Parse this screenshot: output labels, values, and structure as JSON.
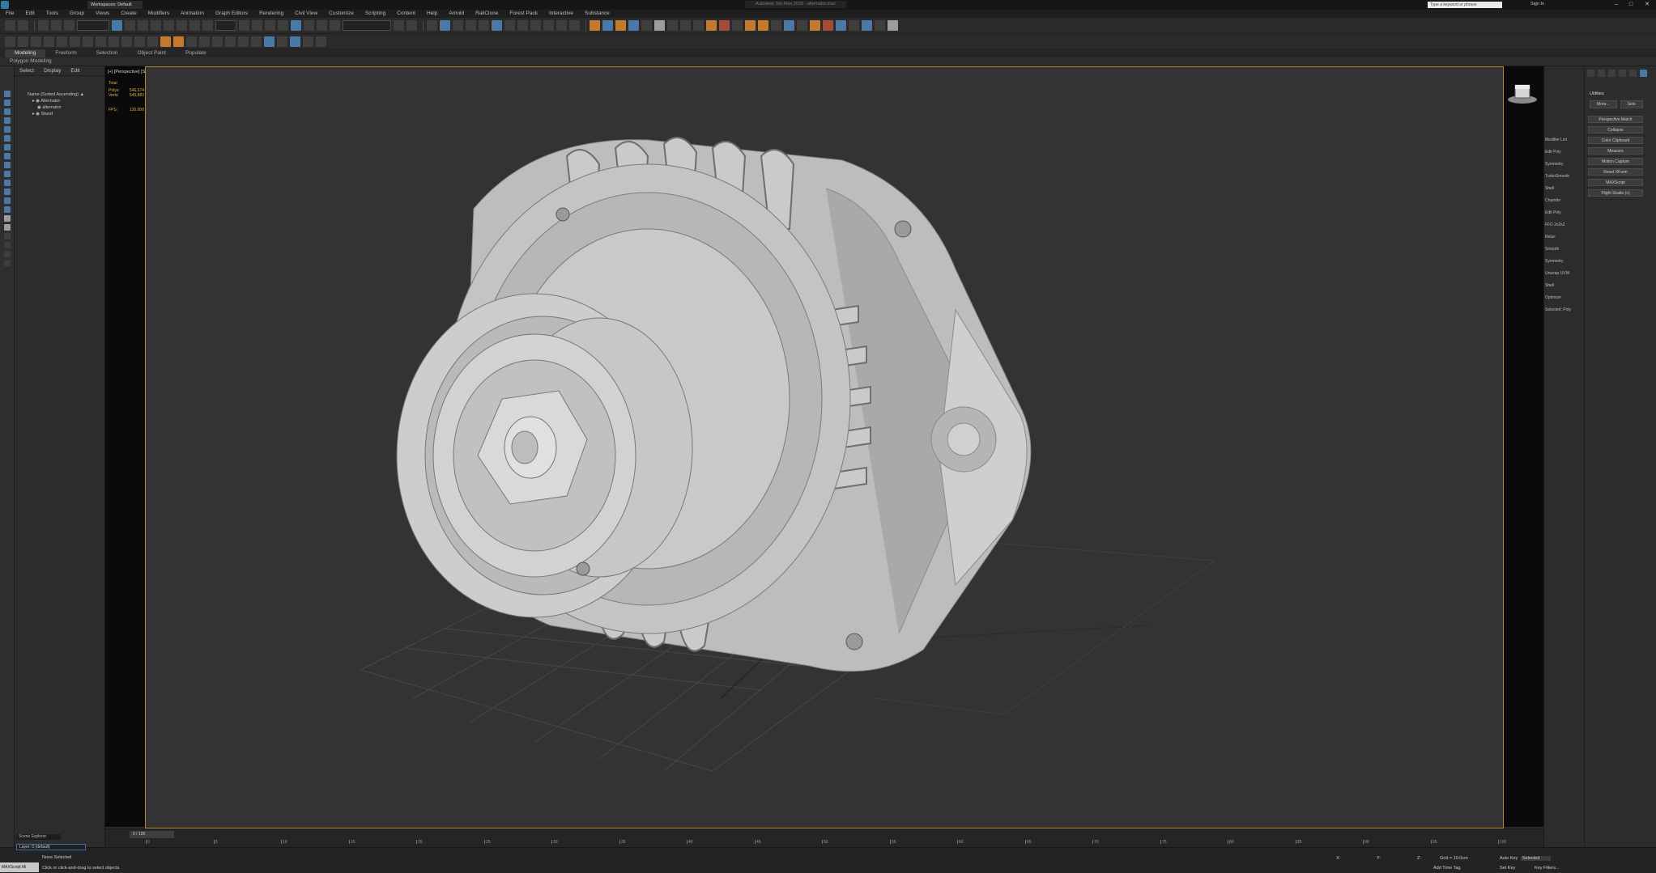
{
  "window": {
    "tab_title": "Workspaces: Default",
    "app_title": "Autodesk 3ds Max 2020 - alternator.max",
    "search_placeholder": "Type a keyword or phrase",
    "signin_label": "Sign In"
  },
  "menu": [
    "File",
    "Edit",
    "Tools",
    "Group",
    "Views",
    "Create",
    "Modifiers",
    "Animation",
    "Graph Editors",
    "Rendering",
    "Civil View",
    "Customize",
    "Scripting",
    "Content",
    "Help",
    "Arnold",
    "RailClone",
    "Forest Pack",
    "Interactive",
    "Substance"
  ],
  "ribbon_tabs": [
    "Modeling",
    "Freeform",
    "Selection",
    "Object Paint",
    "Populate"
  ],
  "subribbon_label": "Polygon Modeling",
  "scene_tabs": [
    "Select",
    "Display",
    "Edit"
  ],
  "scene_tree": [
    {
      "label": "Name (Sorted Ascending) ▲",
      "indent": 0
    },
    {
      "label": "Alternator",
      "indent": 1
    },
    {
      "label": "alternator",
      "indent": 2
    },
    {
      "label": "Stand",
      "indent": 1
    }
  ],
  "viewport": {
    "label": "[+] [Perspective] [Standard] [Default Shading]",
    "stats": [
      {
        "label": "Total",
        "value": ""
      },
      {
        "label": "Polys:",
        "value": "546,674"
      },
      {
        "label": "Verts:",
        "value": "545,883"
      },
      {
        "label": "FPS:",
        "value": "120.000"
      }
    ]
  },
  "command_panel": {
    "modifier_list": [
      "Modifier List",
      "Edit Poly",
      "Symmetry",
      "TurboSmooth",
      "Shell",
      "Chamfer",
      "Edit Poly",
      "FFD 2x2x2",
      "Relax",
      "Smooth",
      "Symmetry",
      "Unwrap UVW",
      "Shell",
      "Optimize",
      "Selected: Poly"
    ],
    "utilities_title": "Utilities",
    "utilities_more": "More...",
    "utilities_sets": "Sets",
    "utility_buttons": [
      "Perspective Match",
      "Collapse",
      "Color Clipboard",
      "Measure",
      "Motion Capture",
      "Reset XForm",
      "MAXScript",
      "Flight Studio (c)"
    ]
  },
  "timeline": {
    "frame_counter": "0 / 100",
    "ticks": [
      "0",
      "5",
      "10",
      "15",
      "20",
      "25",
      "30",
      "35",
      "40",
      "45",
      "50",
      "55",
      "60",
      "65",
      "70",
      "75",
      "80",
      "85",
      "90",
      "95",
      "100"
    ]
  },
  "statusbar": {
    "layer": "Layer: 0 (default)",
    "scene_explorer": "Scene Explorer",
    "maxscript_tag": "MAXScript Mi",
    "status_line1": "None Selected",
    "status_line2": "Click or click-and-drag to select objects",
    "x_label": "X:",
    "y_label": "Y:",
    "z_label": "Z:",
    "grid_label": "Grid = 10.0cm",
    "add_time_tag": "Add Time Tag",
    "auto_key": "Auto Key",
    "set_key": "Set Key",
    "selected_option": "Selected",
    "key_filters": "Key Filters..."
  },
  "colors": {
    "accent": "#4a79a6",
    "viewport_bg": "#333333",
    "viewport_border": "#b08a2a",
    "stats_text": "#d9b34a"
  }
}
